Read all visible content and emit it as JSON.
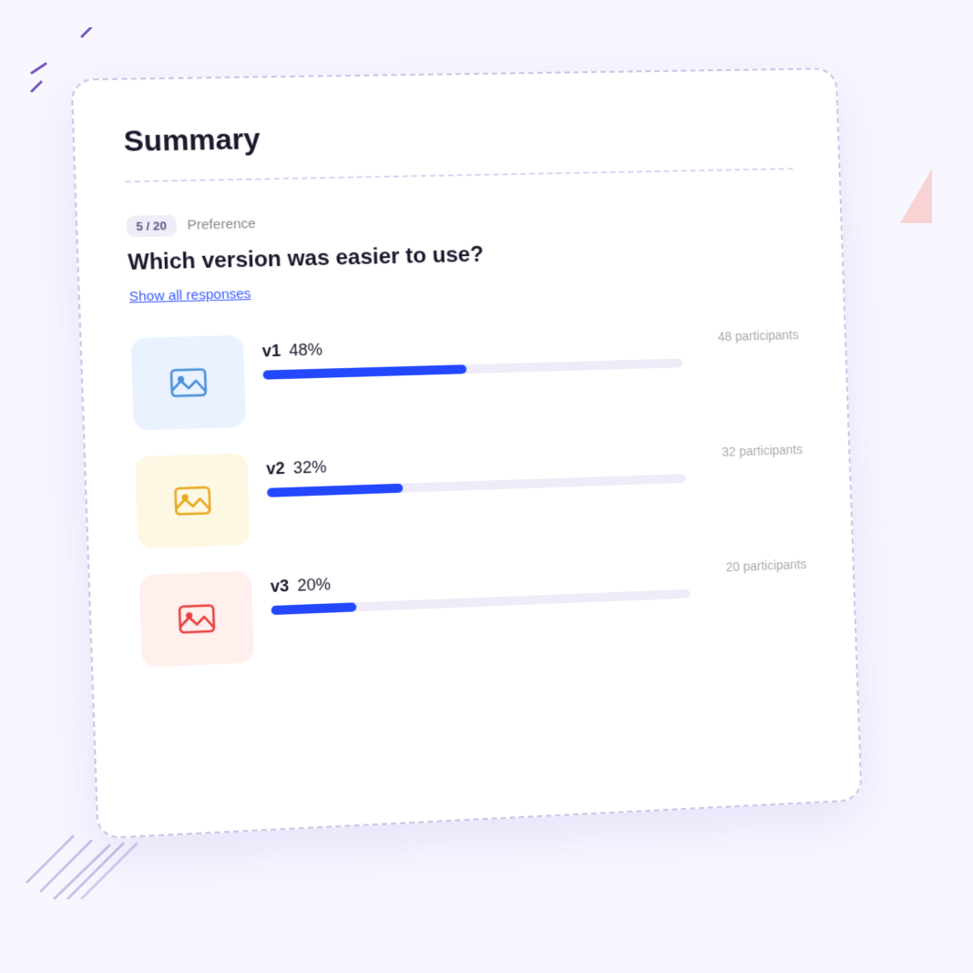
{
  "page": {
    "background_color": "#f8f7ff"
  },
  "card": {
    "title": "Summary",
    "divider": true
  },
  "question": {
    "badge": "5 / 20",
    "type": "Preference",
    "text": "Which version was easier to use?",
    "show_responses_label": "Show all responses"
  },
  "participants_label": "48 participants",
  "versions": [
    {
      "id": "v1",
      "label": "v1",
      "percentage": "48%",
      "percentage_value": 48,
      "participants": "48 participants",
      "bg_class": "v1",
      "icon_color": "#4a90d9"
    },
    {
      "id": "v2",
      "label": "v2",
      "percentage": "32%",
      "percentage_value": 32,
      "participants": "32 participants",
      "bg_class": "v2",
      "icon_color": "#e8a820"
    },
    {
      "id": "v3",
      "label": "v3",
      "percentage": "20%",
      "percentage_value": 20,
      "participants": "20 participants",
      "bg_class": "v3",
      "icon_color": "#e84040"
    }
  ]
}
